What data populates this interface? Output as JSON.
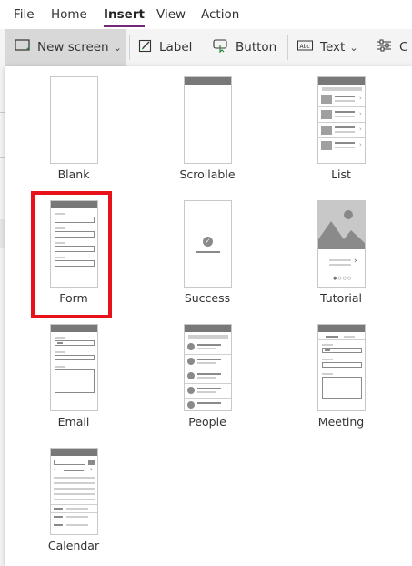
{
  "menu": {
    "items": [
      {
        "label": "File"
      },
      {
        "label": "Home"
      },
      {
        "label": "Insert",
        "active": true
      },
      {
        "label": "View"
      },
      {
        "label": "Action"
      }
    ]
  },
  "ribbon": {
    "new_screen": {
      "label": "New screen",
      "icon": "new-screen-icon"
    },
    "label": {
      "label": "Label",
      "icon": "label-icon"
    },
    "button": {
      "label": "Button",
      "icon": "button-icon"
    },
    "text": {
      "label": "Text",
      "icon": "text-icon"
    },
    "controls": {
      "label": "C",
      "icon": "controls-icon"
    }
  },
  "layouts": [
    {
      "name": "Blank"
    },
    {
      "name": "Scrollable"
    },
    {
      "name": "List"
    },
    {
      "name": "Form",
      "highlighted": true
    },
    {
      "name": "Success"
    },
    {
      "name": "Tutorial"
    },
    {
      "name": "Email"
    },
    {
      "name": "People"
    },
    {
      "name": "Meeting"
    },
    {
      "name": "Calendar"
    }
  ],
  "colors": {
    "accent": "#742774",
    "highlight": "#e8111b",
    "ribbon_bg": "#f4f4f4",
    "selected_bg": "#d8d8d8"
  }
}
